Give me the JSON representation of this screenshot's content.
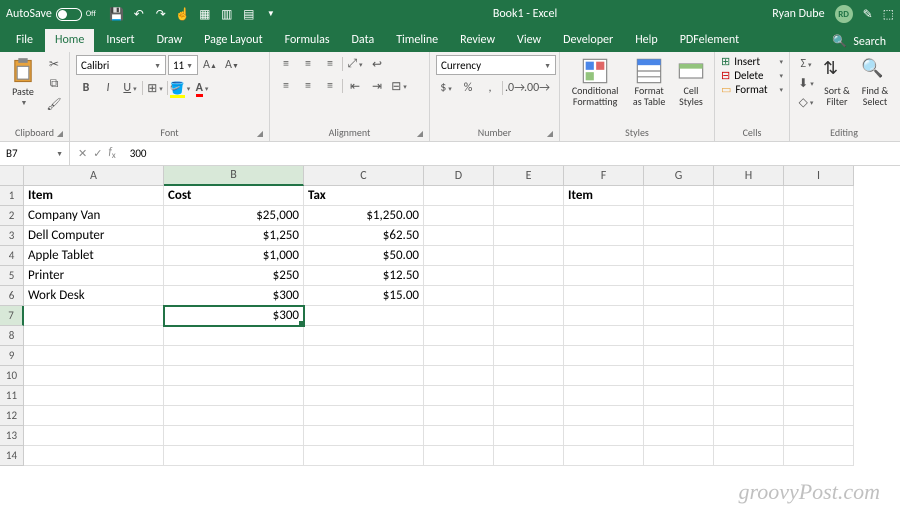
{
  "title": "Book1 - Excel",
  "user": {
    "name": "Ryan Dube",
    "initials": "RD"
  },
  "autosave": {
    "label": "AutoSave",
    "state": "Off"
  },
  "tabs": [
    "File",
    "Home",
    "Insert",
    "Draw",
    "Page Layout",
    "Formulas",
    "Data",
    "Timeline",
    "Review",
    "View",
    "Developer",
    "Help",
    "PDFelement"
  ],
  "active_tab": "Home",
  "search_label": "Search",
  "ribbon": {
    "clipboard": {
      "label": "Clipboard",
      "paste": "Paste"
    },
    "font": {
      "label": "Font",
      "name": "Calibri",
      "size": "11"
    },
    "alignment": {
      "label": "Alignment"
    },
    "number": {
      "label": "Number",
      "format": "Currency"
    },
    "styles": {
      "label": "Styles",
      "cf": "Conditional Formatting",
      "fat": "Format as Table",
      "cs": "Cell Styles"
    },
    "cells": {
      "label": "Cells",
      "insert": "Insert",
      "delete": "Delete",
      "format": "Format"
    },
    "editing": {
      "label": "Editing",
      "sort": "Sort & Filter",
      "find": "Find & Select"
    }
  },
  "namebox": "B7",
  "formula": "300",
  "columns": [
    "A",
    "B",
    "C",
    "D",
    "E",
    "F",
    "G",
    "H",
    "I"
  ],
  "headers": {
    "A": "Item",
    "B": "Cost",
    "C": "Tax",
    "F": "Item"
  },
  "rows": [
    {
      "n": 2,
      "A": "Company Van",
      "B": "$25,000",
      "C": "$1,250.00"
    },
    {
      "n": 3,
      "A": "Dell Computer",
      "B": "$1,250",
      "C": "$62.50"
    },
    {
      "n": 4,
      "A": "Apple Tablet",
      "B": "$1,000",
      "C": "$50.00"
    },
    {
      "n": 5,
      "A": "Printer",
      "B": "$250",
      "C": "$12.50"
    },
    {
      "n": 6,
      "A": "Work Desk",
      "B": "$300",
      "C": "$15.00"
    }
  ],
  "selected": {
    "row": 7,
    "col": "B",
    "value": "$300"
  },
  "watermark": "groovyPost.com"
}
